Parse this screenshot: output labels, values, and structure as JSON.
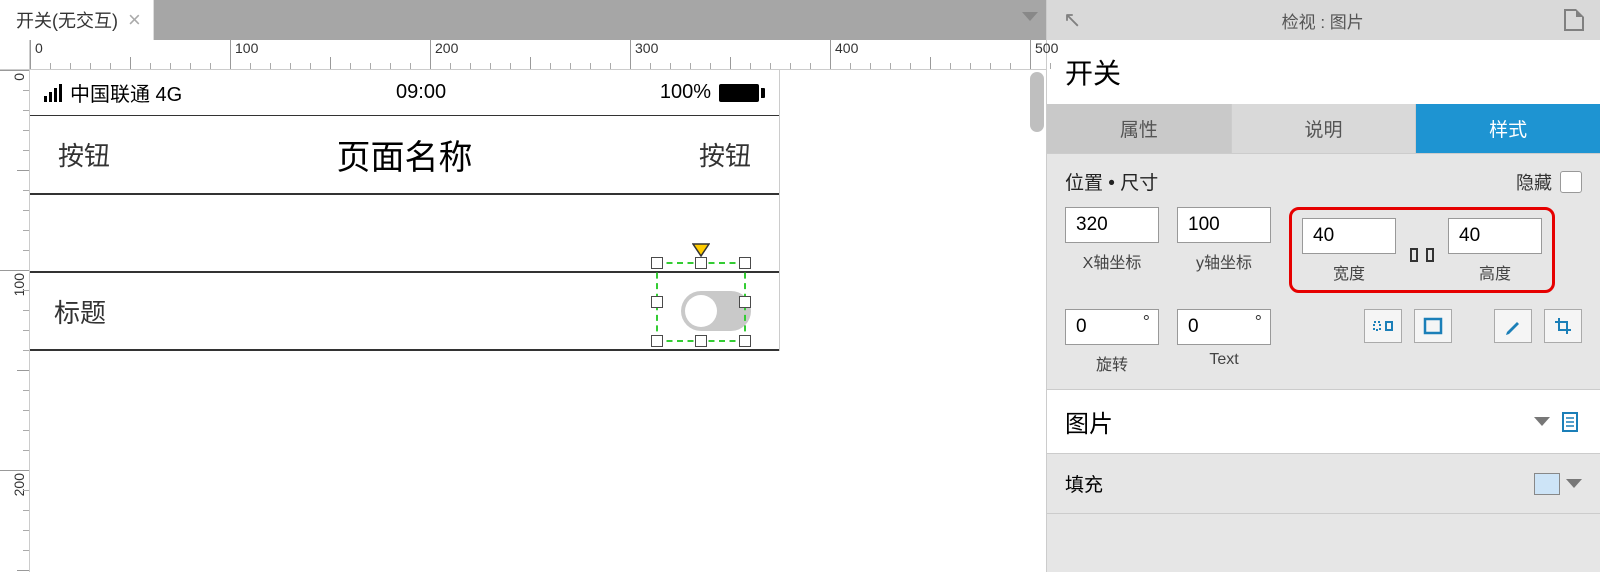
{
  "tab": {
    "title": "开关(无交互)"
  },
  "ruler": {
    "marks_h": [
      "0",
      "100",
      "200",
      "300",
      "400",
      "500"
    ],
    "marks_v": [
      "0",
      "100",
      "200"
    ]
  },
  "phone": {
    "carrier": "中国联通 4G",
    "time": "09:00",
    "battery": "100%",
    "nav_left": "按钮",
    "nav_title": "页面名称",
    "nav_right": "按钮",
    "row_title": "标题"
  },
  "inspector": {
    "header": "检视 : 图片",
    "element_name": "开关",
    "tabs": {
      "props": "属性",
      "notes": "说明",
      "style": "样式"
    },
    "pos_size": "位置 • 尺寸",
    "hide": "隐藏",
    "x": "320",
    "x_label": "X轴坐标",
    "y": "100",
    "y_label": "y轴坐标",
    "w": "40",
    "w_label": "宽度",
    "h": "40",
    "h_label": "高度",
    "rot": "0",
    "rot_label": "旋转",
    "text": "0",
    "text_label": "Text",
    "section_image": "图片",
    "section_fill": "填充"
  }
}
